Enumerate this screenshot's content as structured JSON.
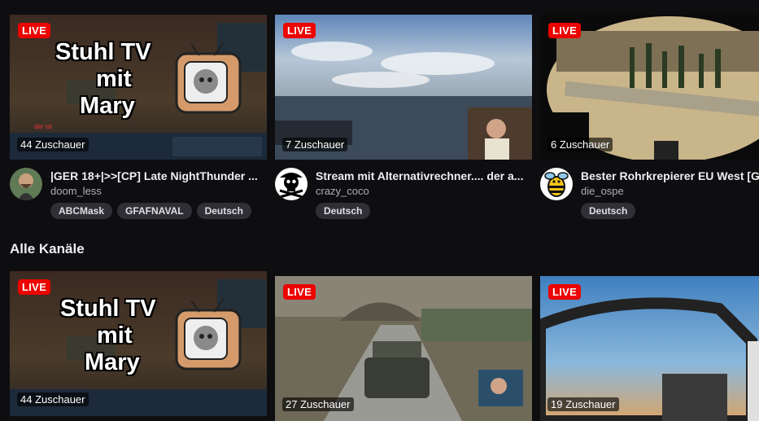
{
  "top_row": [
    {
      "live": "LIVE",
      "viewers": "44 Zuschauer",
      "overlay_line1": "Stuhl TV",
      "overlay_line2": "mit",
      "overlay_line3": "Mary",
      "title": "|GER 18+|>>[CP] Late NightThunder ...",
      "channel": "doom_less",
      "tags": [
        "ABCMask",
        "GFAFNAVAL",
        "Deutsch"
      ],
      "avatar_icon": "avatar-man-beard"
    },
    {
      "live": "LIVE",
      "viewers": "7 Zuschauer",
      "title": "Stream mit Alternativrechner.... der a...",
      "channel": "crazy_coco",
      "tags": [
        "Deutsch"
      ],
      "avatar_icon": "skull-crossbones-icon"
    },
    {
      "live": "LIVE",
      "viewers": "6 Zuschauer",
      "title": "Bester Rohrkrepierer EU West [G",
      "channel": "die_ospe",
      "tags": [
        "Deutsch"
      ],
      "avatar_icon": "bee-icon"
    }
  ],
  "section_title": "Alle Kanäle",
  "bottom_row": [
    {
      "live": "LIVE",
      "viewers": "44 Zuschauer",
      "overlay_line1": "Stuhl TV",
      "overlay_line2": "mit",
      "overlay_line3": "Mary"
    },
    {
      "live": "LIVE",
      "viewers": "27 Zuschauer"
    },
    {
      "live": "LIVE",
      "viewers": "19 Zuschauer"
    }
  ],
  "colors": {
    "background": "#0e0e10",
    "live_badge": "#eb0400",
    "tag_bg": "#2f2f35",
    "muted_text": "#adadb8"
  }
}
